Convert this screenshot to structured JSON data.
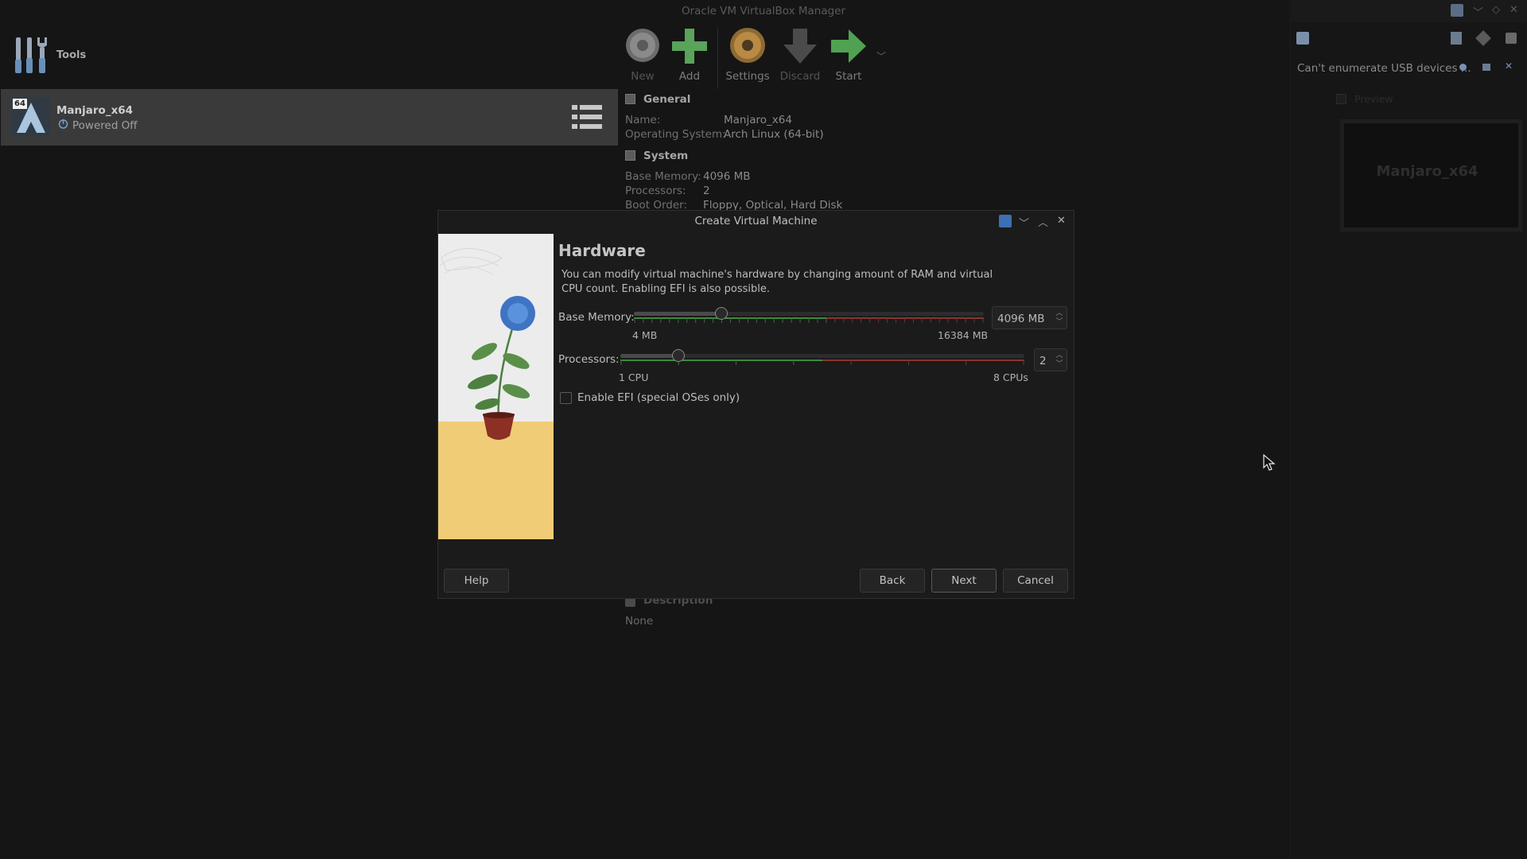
{
  "window": {
    "title": "Oracle VM VirtualBox Manager"
  },
  "sidebar": {
    "tools_label": "Tools",
    "vm": {
      "name": "Manjaro_x64",
      "state": "Powered Off",
      "badge": "64"
    }
  },
  "toolbar": {
    "new_label": "New",
    "add_label": "Add",
    "settings_label": "Settings",
    "discard_label": "Discard",
    "start_label": "Start"
  },
  "details": {
    "general": {
      "title": "General",
      "name_key": "Name:",
      "name_value": "Manjaro_x64",
      "os_key": "Operating System:",
      "os_value": "Arch Linux (64-bit)"
    },
    "system": {
      "title": "System",
      "memory_key": "Base Memory:",
      "memory_value": "4096 MB",
      "processors_key": "Processors:",
      "processors_value": "2",
      "boot_key": "Boot Order:",
      "boot_value": "Floppy, Optical, Hard Disk"
    },
    "description": {
      "title": "Description",
      "value": "None"
    }
  },
  "right_panel": {
    "usb_message": "Can't enumerate USB devices ...",
    "preview_label": "Preview",
    "preview_name": "Manjaro_x64"
  },
  "dialog": {
    "title": "Create Virtual Machine",
    "heading": "Hardware",
    "description": "You can modify virtual machine's hardware by changing amount of RAM and virtual CPU count. Enabling EFI is also possible.",
    "memory": {
      "label": "Base Memory:",
      "value": "4096 MB",
      "min_label": "4 MB",
      "max_label": "16384 MB",
      "level": 0.25
    },
    "processors": {
      "label": "Processors:",
      "value": "2",
      "min_label": "1 CPU",
      "max_label": "8 CPUs",
      "level": 0.143
    },
    "efi_label": "Enable EFI (special OSes only)",
    "efi_checked": false,
    "help_label": "Help",
    "back_label": "Back",
    "next_label": "Next",
    "cancel_label": "Cancel"
  },
  "colors": {
    "background": "#141414",
    "vm_selected": "#3a3a3a",
    "add_green": "#5aa35a",
    "settings_orange": "#b98a43",
    "start_green": "#4fa252",
    "slider_green": "#3e8a3e",
    "slider_red": "#8a3333"
  }
}
